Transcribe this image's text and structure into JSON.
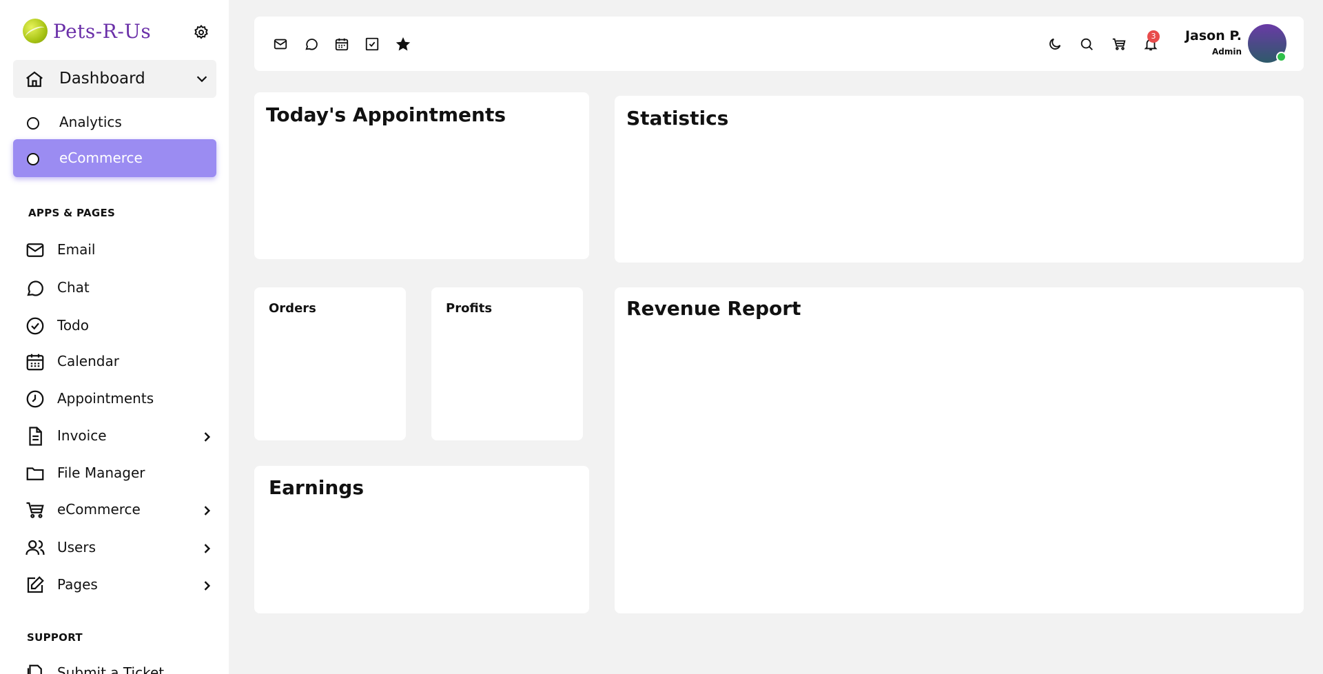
{
  "brand": {
    "name": "Pets-R-Us"
  },
  "sidebar": {
    "dashboard_label": "Dashboard",
    "dashboard_sub": [
      {
        "label": "Analytics",
        "active": false
      },
      {
        "label": "eCommerce",
        "active": true
      }
    ],
    "section_apps": "APPS & PAGES",
    "items": [
      {
        "label": "Email",
        "icon": "mail-icon"
      },
      {
        "label": "Chat",
        "icon": "chat-icon"
      },
      {
        "label": "Todo",
        "icon": "check-circle-icon"
      },
      {
        "label": "Calendar",
        "icon": "calendar-icon"
      },
      {
        "label": "Appointments",
        "icon": "clock-icon"
      },
      {
        "label": "Invoice",
        "icon": "file-icon",
        "has_children": true
      },
      {
        "label": "File Manager",
        "icon": "folder-icon"
      },
      {
        "label": "eCommerce",
        "icon": "cart-icon",
        "has_children": true
      },
      {
        "label": "Users",
        "icon": "users-icon",
        "has_children": true
      },
      {
        "label": "Pages",
        "icon": "edit-icon",
        "has_children": true
      }
    ],
    "section_support": "SUPPORT",
    "support_items": [
      {
        "label": "Submit a Ticket",
        "icon": "ticket-icon"
      }
    ]
  },
  "topbar": {
    "bookmarks": [
      "mail-icon",
      "chat-icon",
      "calendar-icon",
      "check-square-icon",
      "star-icon"
    ],
    "actions": [
      "moon-icon",
      "search-icon",
      "cart-icon",
      "bell-icon"
    ],
    "notification_count": "3",
    "user": {
      "name": "Jason P.",
      "role": "Admin"
    }
  },
  "cards": {
    "appointments": "Today's Appointments",
    "statistics": "Statistics",
    "orders": "Orders",
    "profits": "Profits",
    "revenue": "Revenue Report",
    "earnings": "Earnings"
  },
  "colors": {
    "brand": "#6a2fa8",
    "active": "#9b8cf2",
    "badge": "#e84c4c",
    "online": "#2fc04a"
  }
}
